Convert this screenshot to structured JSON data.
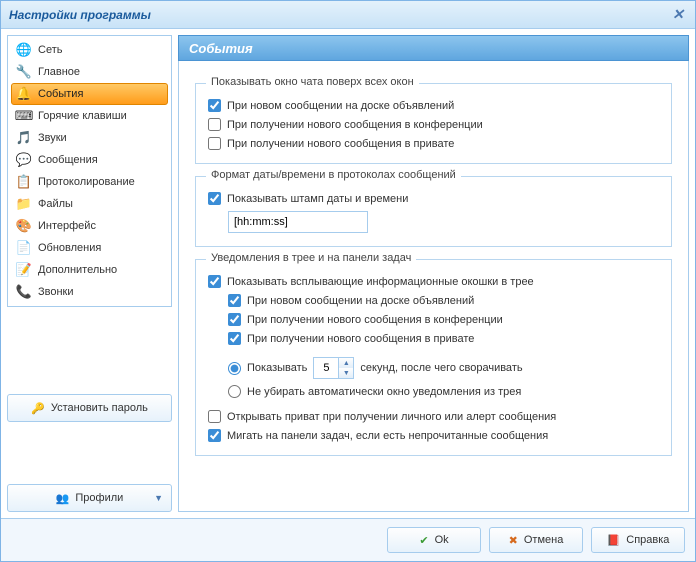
{
  "window": {
    "title": "Настройки программы"
  },
  "sidebar": {
    "items": [
      {
        "label": "Сеть",
        "icon": "🌐"
      },
      {
        "label": "Главное",
        "icon": "🔧"
      },
      {
        "label": "События",
        "icon": "🔔"
      },
      {
        "label": "Горячие клавиши",
        "icon": "⌨"
      },
      {
        "label": "Звуки",
        "icon": "🎵"
      },
      {
        "label": "Сообщения",
        "icon": "💬"
      },
      {
        "label": "Протоколирование",
        "icon": "📋"
      },
      {
        "label": "Файлы",
        "icon": "📁"
      },
      {
        "label": "Интерфейс",
        "icon": "🎨"
      },
      {
        "label": "Обновления",
        "icon": "📄"
      },
      {
        "label": "Дополнительно",
        "icon": "📝"
      },
      {
        "label": "Звонки",
        "icon": "📞"
      }
    ],
    "set_password": "Установить пароль",
    "profiles": "Профили"
  },
  "content": {
    "title": "События",
    "group1": {
      "legend": "Показывать окно чата поверх всех окон",
      "c1": "При новом сообщении на доске объявлений",
      "c2": "При получении нового сообщения в конференции",
      "c3": "При получении нового сообщения в привате"
    },
    "group2": {
      "legend": "Формат даты/времени в протоколах сообщений",
      "c1": "Показывать штамп даты и времени",
      "format_value": "[hh:mm:ss]"
    },
    "group3": {
      "legend": "Уведомления в трее и на панели задач",
      "c1": "Показывать всплывающие информационные окошки в трее",
      "c1a": "При новом сообщении на доске объявлений",
      "c1b": "При получении нового сообщения в конференции",
      "c1c": "При получении нового сообщения в привате",
      "r1_pre": "Показывать",
      "r1_value": "5",
      "r1_post": "секунд, после чего сворачивать",
      "r2": "Не убирать автоматически окно уведомления из трея",
      "c2": "Открывать приват при получении личного или алерт сообщения",
      "c3": "Мигать на панели задач, если есть непрочитанные сообщения"
    }
  },
  "footer": {
    "ok": "Ok",
    "cancel": "Отмена",
    "help": "Справка"
  }
}
